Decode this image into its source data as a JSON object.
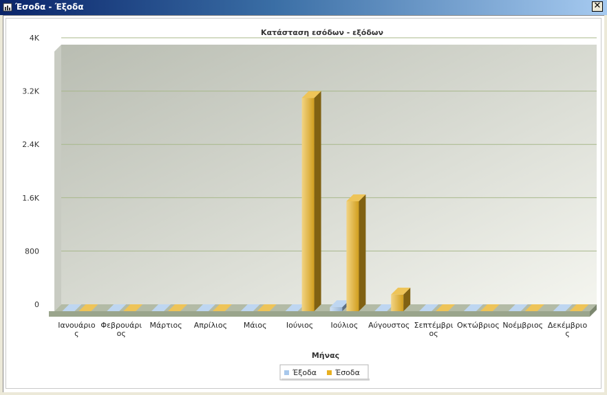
{
  "window": {
    "title": "Έσοδα - Έξοδα",
    "close_glyph": "✕"
  },
  "chart_data": {
    "type": "bar",
    "title": "Κατάσταση εσόδων - εξόδων",
    "xlabel": "Μήνας",
    "ylabel": "",
    "ylim": [
      0,
      4000
    ],
    "yticks": [
      0,
      800,
      1600,
      2400,
      3200,
      4000
    ],
    "ytick_labels": [
      "0",
      "800",
      "1.6K",
      "2.4K",
      "3.2K",
      "4K"
    ],
    "grid": true,
    "legend_position": "bottom",
    "categories": [
      "Ιανουάριος",
      "Φεβρουάριος",
      "Μάρτιος",
      "Απρίλιος",
      "Μάιος",
      "Ιούνιος",
      "Ιούλιος",
      "Αύγουστος",
      "Σεπτέμβριος",
      "Οκτώβριος",
      "Νοέμβριος",
      "Δεκέμβριος"
    ],
    "category_label_lines": [
      [
        "Ιανουάριο",
        "ς"
      ],
      [
        "Φεβρουάρι",
        "ος"
      ],
      [
        "Μάρτιος"
      ],
      [
        "Απρίλιος"
      ],
      [
        "Μάιος"
      ],
      [
        "Ιούνιος"
      ],
      [
        "Ιούλιος"
      ],
      [
        "Αύγουστος"
      ],
      [
        "Σεπτέμβρι",
        "ος"
      ],
      [
        "Οκτώβριος"
      ],
      [
        "Νοέμβριος"
      ],
      [
        "Δεκέμβριο",
        "ς"
      ]
    ],
    "series": [
      {
        "name": "Έξοδα",
        "color": "#a8c8ec",
        "values": [
          0,
          0,
          0,
          0,
          0,
          0,
          60,
          0,
          0,
          0,
          0,
          0
        ]
      },
      {
        "name": "Έσοδα",
        "color": "#e8b020",
        "values": [
          0,
          0,
          0,
          0,
          0,
          3200,
          1650,
          250,
          0,
          0,
          0,
          0
        ]
      }
    ]
  }
}
